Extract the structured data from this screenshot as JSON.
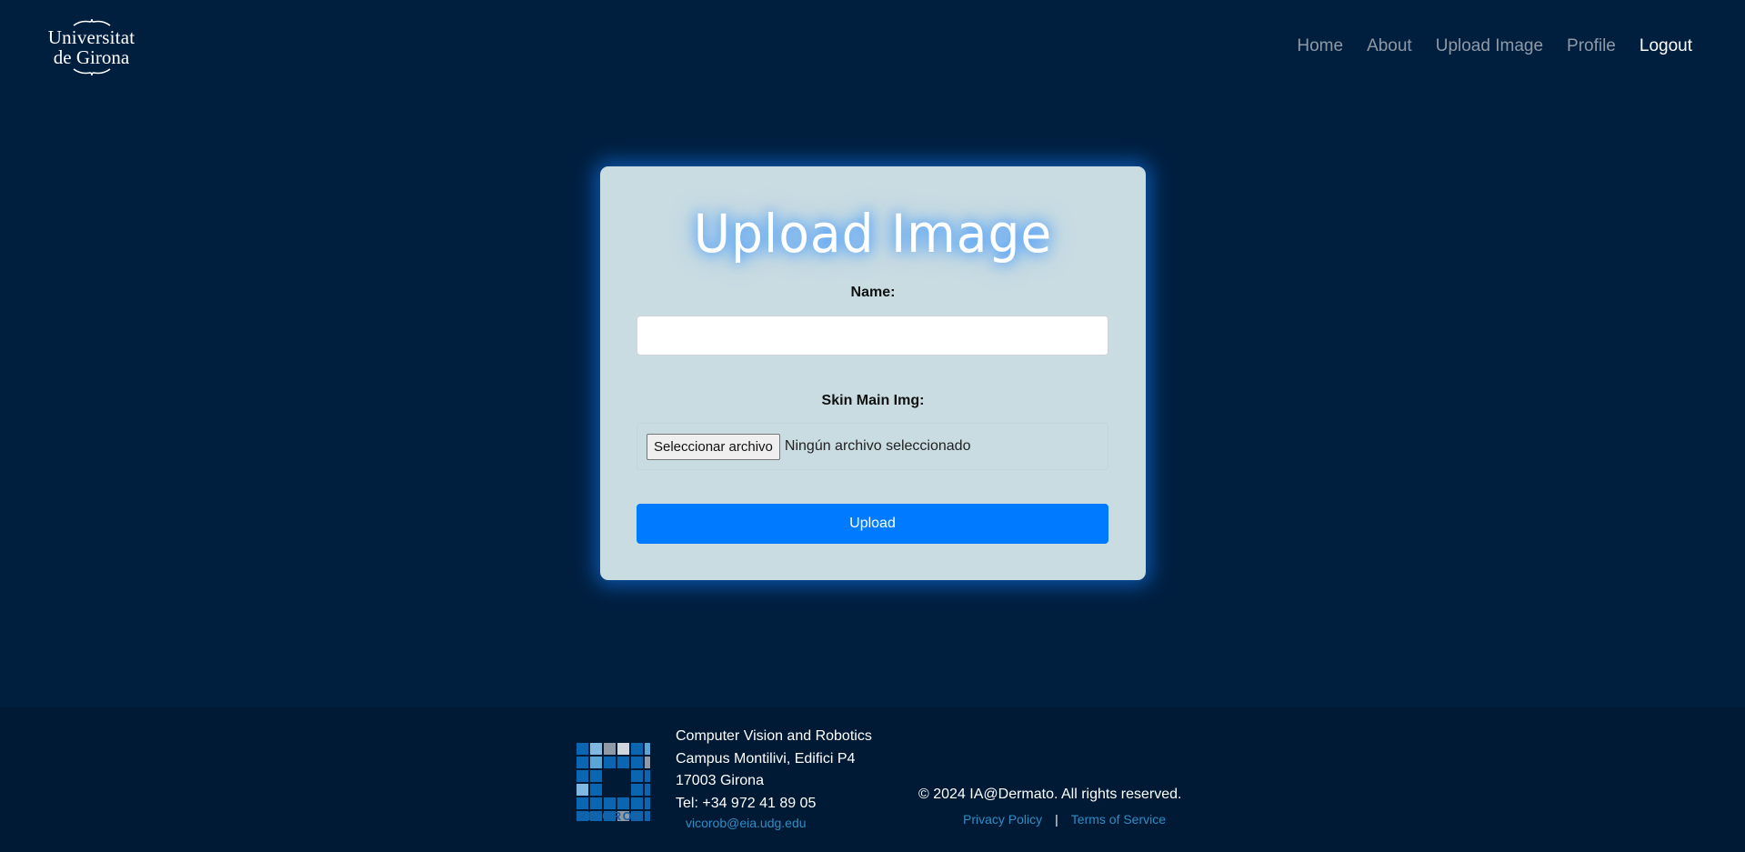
{
  "header": {
    "logo": {
      "line1": "Universitat",
      "line2": "de Girona"
    },
    "nav": [
      {
        "label": "Home"
      },
      {
        "label": "About"
      },
      {
        "label": "Upload Image"
      },
      {
        "label": "Profile"
      },
      {
        "label": "Logout"
      }
    ]
  },
  "form": {
    "title": "Upload Image",
    "name_label": "Name:",
    "name_value": "",
    "image_label": "Skin Main Img:",
    "file_button": "Seleccionar archivo",
    "file_status": "Ningún archivo seleccionado",
    "submit_label": "Upload"
  },
  "footer": {
    "logo_text": "VICOROB",
    "address": [
      "Computer Vision and Robotics",
      "Campus Montilivi, Edifici P4",
      "17003 Girona",
      "Tel: +34 972 41 89 05"
    ],
    "email": "vicorob@eia.udg.edu",
    "copyright": "© 2024 IA@Dermato. All rights reserved.",
    "privacy": "Privacy Policy",
    "separator": "|",
    "terms": "Terms of Service"
  },
  "colors": {
    "background": "#001f3f",
    "card": "#c9dce2",
    "primary": "#007bff",
    "footer": "#001a35",
    "link": "#2f8dc4"
  }
}
